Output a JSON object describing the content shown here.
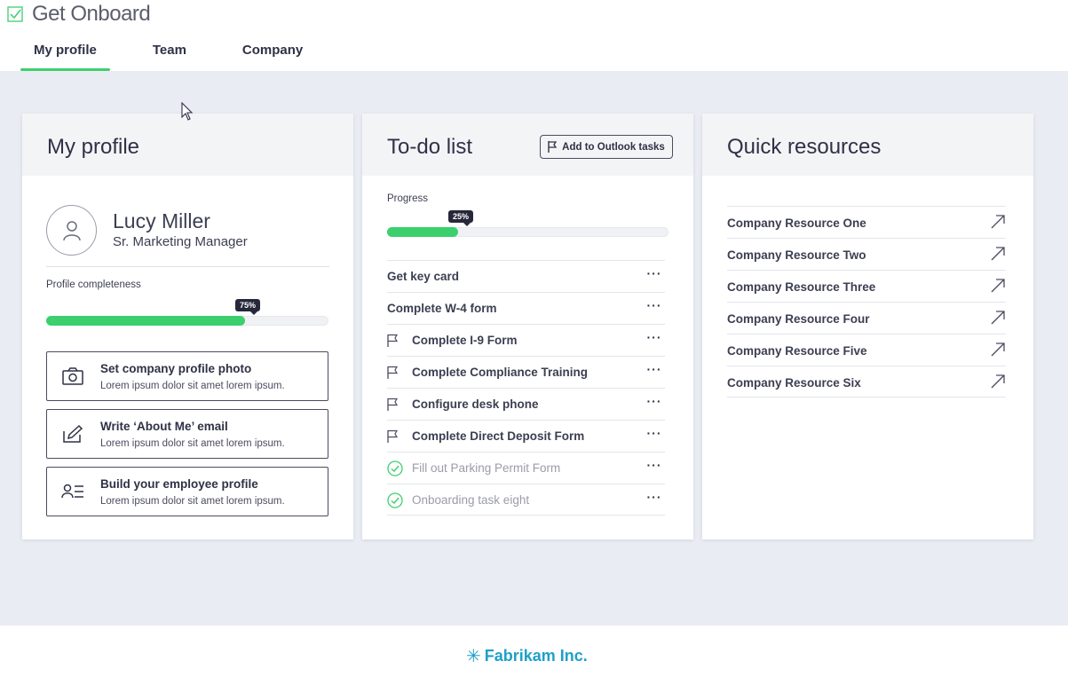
{
  "app": {
    "title": "Get Onboard"
  },
  "tabs": [
    {
      "label": "My profile",
      "active": true
    },
    {
      "label": "Team",
      "active": false
    },
    {
      "label": "Company",
      "active": false
    }
  ],
  "profile": {
    "title": "My profile",
    "name": "Lucy Miller",
    "role": "Sr. Marketing Manager",
    "completeness_label": "Profile completeness",
    "completeness_value": "75%",
    "actions": [
      {
        "title": "Set company profile photo",
        "desc": "Lorem ipsum dolor sit amet lorem ipsum.",
        "icon": "camera-icon"
      },
      {
        "title": "Write ‘About Me’ email",
        "desc": "Lorem ipsum dolor sit amet lorem ipsum.",
        "icon": "edit-icon"
      },
      {
        "title": "Build your employee profile",
        "desc": "Lorem ipsum dolor sit amet lorem ipsum.",
        "icon": "profile-list-icon"
      }
    ]
  },
  "todo": {
    "title": "To-do list",
    "outlook_button": "Add to Outlook tasks",
    "progress_label": "Progress",
    "progress_value": "25%",
    "more_glyph": "···",
    "items": [
      {
        "label": "Get key card",
        "state": "none"
      },
      {
        "label": "Complete W-4 form",
        "state": "none"
      },
      {
        "label": "Complete I-9 Form",
        "state": "flag"
      },
      {
        "label": "Complete Compliance Training",
        "state": "flag"
      },
      {
        "label": "Configure desk phone",
        "state": "flag"
      },
      {
        "label": "Complete Direct Deposit Form",
        "state": "flag"
      },
      {
        "label": "Fill out Parking Permit Form",
        "state": "done"
      },
      {
        "label": "Onboarding task eight",
        "state": "done"
      }
    ]
  },
  "resources": {
    "title": "Quick resources",
    "items": [
      "Company Resource One",
      "Company Resource Two",
      "Company Resource Three",
      "Company Resource Four",
      "Company Resource Five",
      "Company Resource Six"
    ]
  },
  "footer": {
    "brand": "Fabrikam Inc.",
    "brand_glyph": "✳"
  },
  "colors": {
    "accent": "#3ccf6e",
    "dark": "#2f3146",
    "brand": "#1fa0c9",
    "background": "#e9edf3"
  }
}
